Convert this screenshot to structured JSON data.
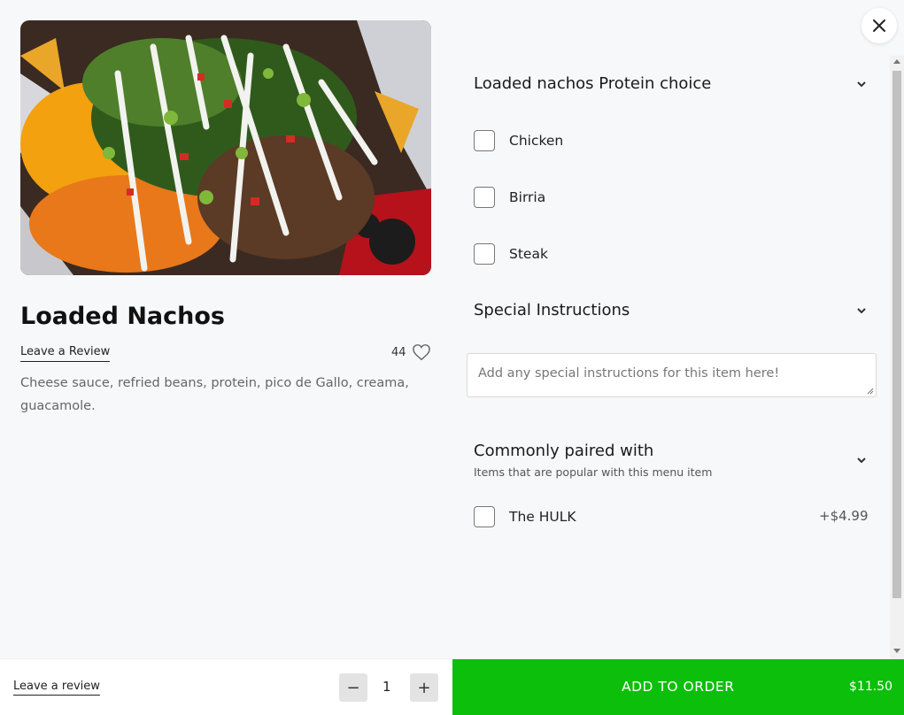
{
  "item": {
    "title": "Loaded Nachos",
    "review_link": "Leave a Review",
    "likes": "44",
    "description": "Cheese sauce, refried beans, protein, pico de Gallo, creama, guacamole."
  },
  "protein_section": {
    "title": "Loaded nachos Protein choice",
    "options": [
      "Chicken",
      "Birria",
      "Steak"
    ]
  },
  "instructions_section": {
    "title": "Special Instructions",
    "placeholder": "Add any special instructions for this item here!"
  },
  "paired_section": {
    "title": "Commonly paired with",
    "subtitle": "Items that are popular with this menu item",
    "items": [
      {
        "label": "The HULK",
        "price": "+$4.99"
      }
    ]
  },
  "footer": {
    "review_link": "Leave a review",
    "minus": "−",
    "plus": "+",
    "quantity": "1",
    "add_label": "ADD TO ORDER",
    "total": "$11.50"
  },
  "colors": {
    "accent": "#0bbf0b",
    "background": "#f7f8fa"
  }
}
